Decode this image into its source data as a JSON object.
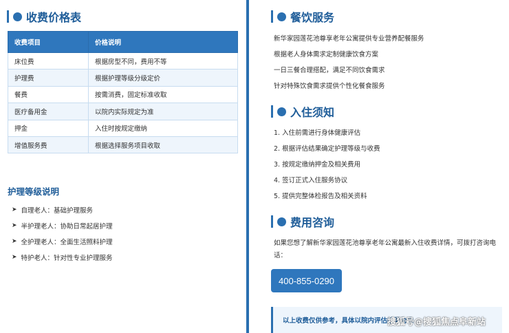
{
  "left": {
    "title": "收费价格表",
    "table": {
      "headers": [
        "收费项目",
        "价格说明"
      ],
      "rows": [
        [
          "床位费",
          "根据房型不同，费用不等"
        ],
        [
          "护理费",
          "根据护理等级分级定价"
        ],
        [
          "餐费",
          "按需消费，固定标准收取"
        ],
        [
          "医疗备用金",
          "以院内实际规定为准"
        ],
        [
          "押金",
          "入住时按规定缴纳"
        ],
        [
          "增值服务费",
          "根据选择服务项目收取"
        ]
      ]
    },
    "levels_title": "护理等级说明",
    "levels": [
      "自理老人：基础护理服务",
      "半护理老人：协助日常起居护理",
      "全护理老人：全面生活照料护理",
      "特护老人：针对性专业护理服务"
    ]
  },
  "right": {
    "catering": {
      "title": "餐饮服务",
      "lines": [
        "新华家园莲花池尊享老年公寓提供专业营养配餐服务",
        "根据老人身体需求定制健康饮食方案",
        "一日三餐合理搭配，满足不同饮食需求",
        "针对特殊饮食需求提供个性化餐食服务"
      ]
    },
    "admission": {
      "title": "入住须知",
      "lines": [
        "1. 入住前需进行身体健康评估",
        "2. 根据评估结果确定护理等级与收费",
        "3. 按规定缴纳押金及相关费用",
        "4. 签订正式入住服务协议",
        "5. 提供完整体检报告及相关资料"
      ]
    },
    "consult": {
      "title": "费用咨询",
      "desc": "如果您想了解新华家园莲花池尊享老年公寓最新入住收费详情，可拨打咨询电话：",
      "phone": "400-855-0290",
      "notice": "以上收费仅供参考，具体以院内评估结果为准"
    }
  },
  "watermark": "搜狐号@搜狐焦点阜新站",
  "colors": {
    "accent": "#2a6fb0",
    "header_bg": "#2f77bd",
    "title": "#1f5d99",
    "row_alt": "#eef5fc"
  }
}
